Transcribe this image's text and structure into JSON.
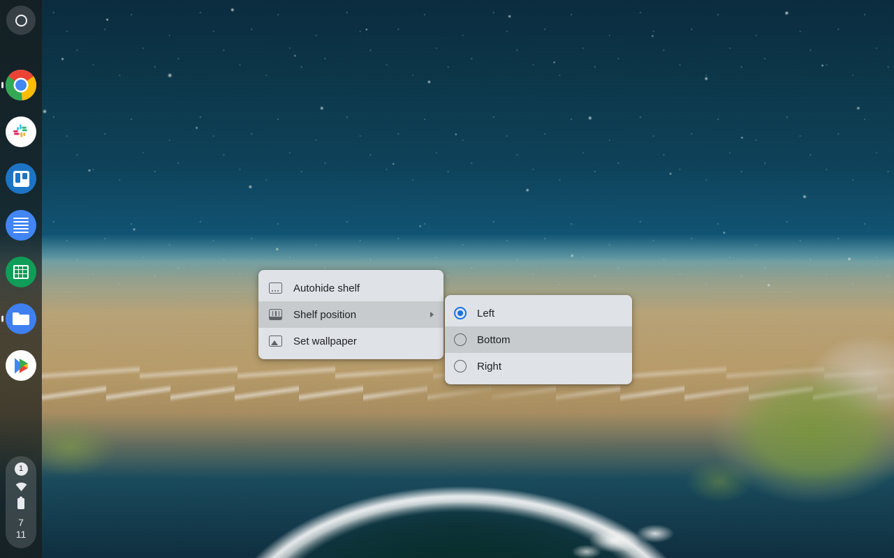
{
  "desktop": {
    "wallpaper_name": "aerial-atoll-wallpaper",
    "wallpaper_colors": {
      "deep_ocean": "#07293c",
      "reef_blue": "#166d8e",
      "sand": "#c0a070",
      "vegetation": "#7d9647",
      "lagoon_dark": "#03231f"
    }
  },
  "shelf": {
    "position": "left",
    "launcher": {
      "label": "Launcher",
      "icon": "launcher-circle-icon"
    },
    "apps": [
      {
        "name": "chrome",
        "label": "Google Chrome",
        "running": true
      },
      {
        "name": "slack",
        "label": "Slack",
        "running": false
      },
      {
        "name": "trello",
        "label": "Trello",
        "running": false
      },
      {
        "name": "docs",
        "label": "Google Docs",
        "running": false
      },
      {
        "name": "sheets",
        "label": "Google Sheets",
        "running": false
      },
      {
        "name": "files",
        "label": "Files",
        "running": true
      },
      {
        "name": "play",
        "label": "Play Store",
        "running": false
      }
    ],
    "status": {
      "notification_count": "1",
      "wifi": "wifi-icon",
      "battery": "battery-icon",
      "time_hour": "7",
      "time_minute": "11"
    }
  },
  "context_menu": {
    "items": [
      {
        "label": "Autohide shelf",
        "icon": "shelf-frame-icon",
        "has_submenu": false,
        "hovered": false
      },
      {
        "label": "Shelf position",
        "icon": "shelf-layout-icon",
        "has_submenu": true,
        "hovered": true
      },
      {
        "label": "Set wallpaper",
        "icon": "image-icon",
        "has_submenu": false,
        "hovered": false
      }
    ]
  },
  "shelf_position_submenu": {
    "options": [
      {
        "label": "Left",
        "selected": true,
        "hovered": false
      },
      {
        "label": "Bottom",
        "selected": false,
        "hovered": true
      },
      {
        "label": "Right",
        "selected": false,
        "hovered": false
      }
    ]
  },
  "colors": {
    "menu_bg": "#dfe2e6",
    "menu_hover": "#c7cbcd",
    "menu_text": "#202124",
    "accent_blue": "#1a73e8",
    "shelf_bg": "rgba(24,27,26,0.70)"
  }
}
